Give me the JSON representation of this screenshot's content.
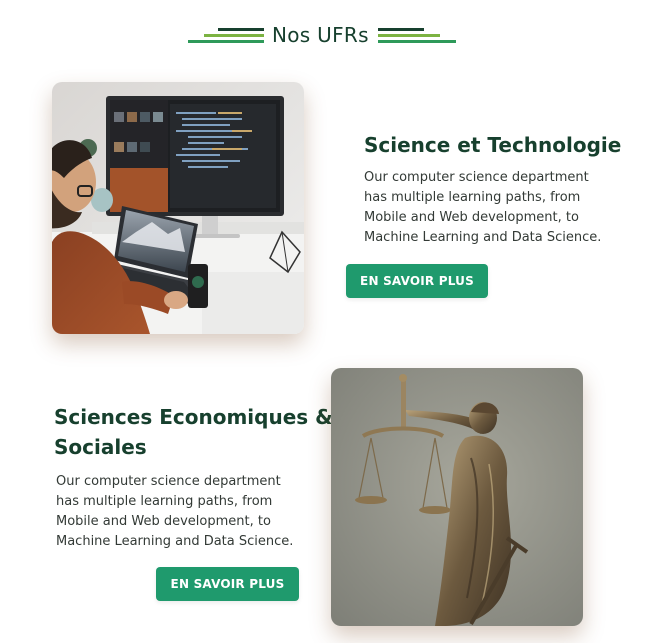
{
  "header": {
    "title": "Nos UFRs"
  },
  "ufrs": [
    {
      "image_alt": "computer-workstation",
      "title": "Science et Technologie",
      "description": [
        "Our computer science department",
        "has multiple learning paths, from",
        "Mobile and Web development, to",
        "Machine Learning and Data Science."
      ],
      "button_label": "EN SAVOIR PLUS"
    },
    {
      "image_alt": "lady-justice-statue",
      "title_lines": [
        "Sciences Economiques &",
        "Sociales"
      ],
      "description": [
        "Our computer science department",
        "has multiple learning paths, from",
        "Mobile and Web development, to",
        "Machine Learning and Data Science."
      ],
      "button_label": "EN SAVOIR PLUS"
    }
  ],
  "colors": {
    "accent_dark": "#17402e",
    "accent_green": "#7cb342",
    "button": "#1f9a6d"
  }
}
